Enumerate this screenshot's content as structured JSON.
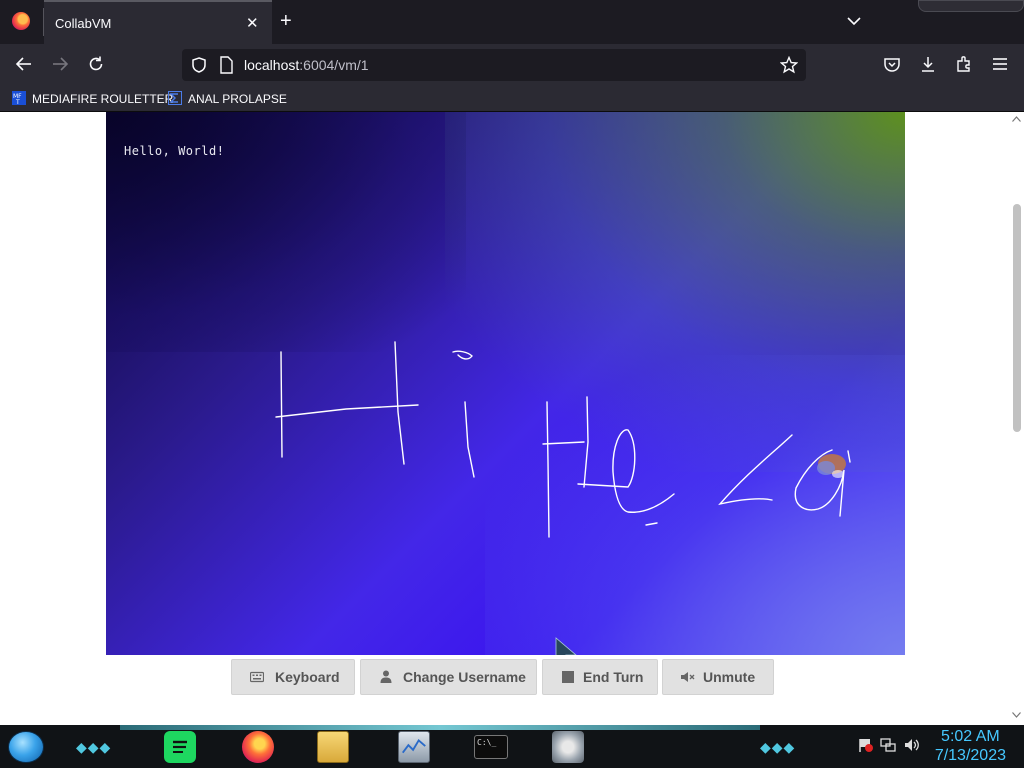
{
  "browser": {
    "tab_title": "CollabVM",
    "tab_close": "✕",
    "new_tab": "+",
    "url_host": "localhost",
    "url_path": ":6004/vm/1",
    "bookmarks": [
      {
        "label": "MEDIAFIRE ROULETTER",
        "icon": "mediafire-icon"
      },
      {
        "label": "ANAL PROLAPSE",
        "icon": "sigma-icon"
      }
    ]
  },
  "vm": {
    "hello_text": "Hello, World!"
  },
  "controls": {
    "keyboard_label": "Keyboard",
    "change_username_label": "Change Username",
    "end_turn_label": "End Turn",
    "unmute_label": "Unmute"
  },
  "taskbar": {
    "time": "5:02 AM",
    "date": "7/13/2023"
  }
}
